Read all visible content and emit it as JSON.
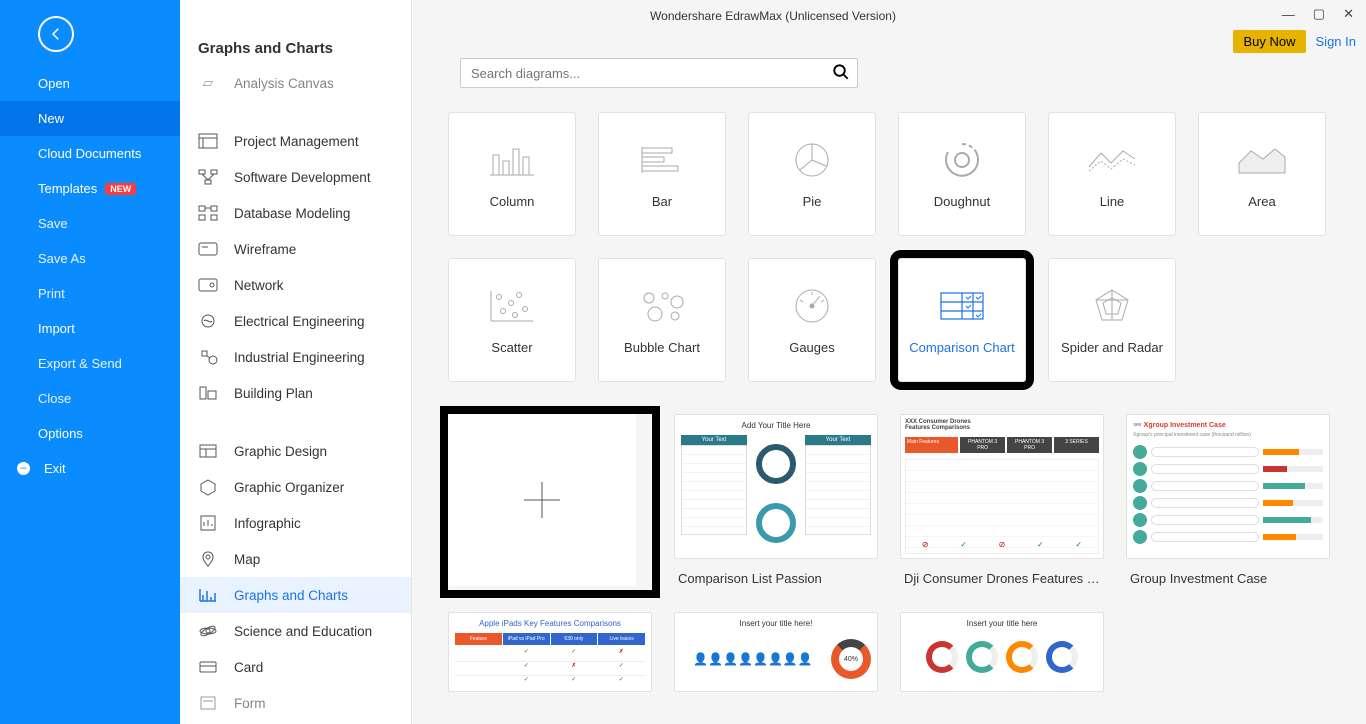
{
  "window": {
    "title": "Wondershare EdrawMax (Unlicensed Version)",
    "buy_now": "Buy Now",
    "sign_in": "Sign In"
  },
  "nav": {
    "open": "Open",
    "new": "New",
    "cloud": "Cloud Documents",
    "templates": "Templates",
    "templates_badge": "NEW",
    "save": "Save",
    "save_as": "Save As",
    "print": "Print",
    "import": "Import",
    "export": "Export & Send",
    "close": "Close",
    "options": "Options",
    "exit": "Exit"
  },
  "panel": {
    "title": "Graphs and Charts"
  },
  "categories": {
    "c0": "Analysis Canvas",
    "c1": "Project Management",
    "c2": "Software Development",
    "c3": "Database Modeling",
    "c4": "Wireframe",
    "c5": "Network",
    "c6": "Electrical Engineering",
    "c7": "Industrial Engineering",
    "c8": "Building Plan",
    "c9": "Graphic Design",
    "c10": "Graphic Organizer",
    "c11": "Infographic",
    "c12": "Map",
    "c13": "Graphs and Charts",
    "c14": "Science and Education",
    "c15": "Card",
    "c16": "Form"
  },
  "search": {
    "placeholder": "Search diagrams..."
  },
  "chart_types": {
    "column": "Column",
    "bar": "Bar",
    "pie": "Pie",
    "doughnut": "Doughnut",
    "line": "Line",
    "area": "Area",
    "scatter": "Scatter",
    "bubble": "Bubble Chart",
    "gauges": "Gauges",
    "comparison": "Comparison Chart",
    "spider": "Spider and Radar"
  },
  "templates": {
    "t1": "Comparison List Passion",
    "t2": "Dji Consumer Drones Features C...",
    "t3": "Group Investment Case"
  }
}
